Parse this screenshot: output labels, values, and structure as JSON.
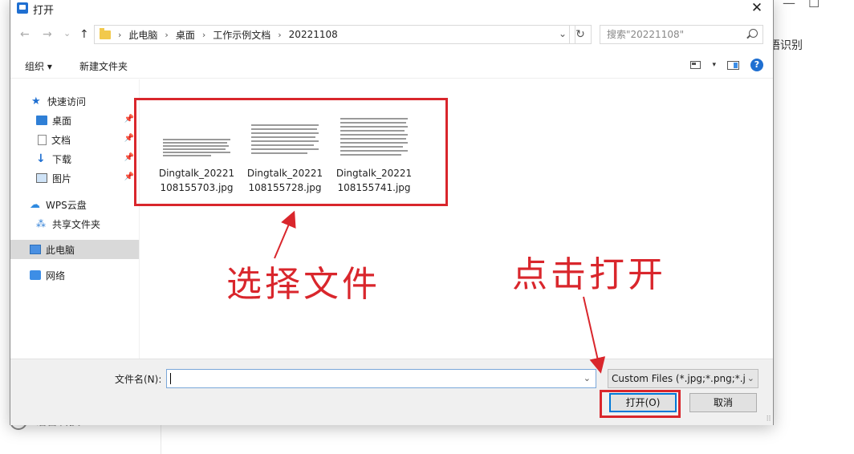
{
  "background_app": {
    "right_label": "语识别",
    "sidebar_item_label": "语音转换",
    "window_controls": [
      "—",
      "☐"
    ]
  },
  "dialog": {
    "title": "打开",
    "close_glyph": "✕",
    "nav": {
      "back_glyph": "←",
      "forward_glyph": "→",
      "recent_glyph": "⌄",
      "up_glyph": "↑",
      "breadcrumbs": [
        "此电脑",
        "桌面",
        "工作示例文档",
        "20221108"
      ],
      "crumb_separator": "›",
      "dropdown_glyph": "⌄",
      "refresh_glyph": "↻",
      "search_placeholder": "搜索\"20221108\""
    },
    "toolbar": {
      "organize_label": "组织 ▾",
      "new_folder_label": "新建文件夹",
      "view_dropdown_glyph": "▾",
      "help_glyph": "?"
    },
    "sidebar": {
      "items": [
        {
          "label": "快速访问",
          "icon": "star-icon",
          "glyph": "★",
          "pinned": false,
          "selected": false
        },
        {
          "label": "桌面",
          "icon": "desktop-icon",
          "pinned": true,
          "selected": false
        },
        {
          "label": "文档",
          "icon": "document-icon",
          "pinned": true,
          "selected": false
        },
        {
          "label": "下载",
          "icon": "download-icon",
          "glyph": "↓",
          "pinned": true,
          "selected": false
        },
        {
          "label": "图片",
          "icon": "pictures-icon",
          "pinned": true,
          "selected": false
        },
        {
          "label": "WPS云盘",
          "icon": "cloud-icon",
          "glyph": "☁",
          "pinned": false,
          "selected": false
        },
        {
          "label": "共享文件夹",
          "icon": "share-icon",
          "glyph": "⁂",
          "pinned": false,
          "selected": false
        },
        {
          "label": "此电脑",
          "icon": "computer-icon",
          "pinned": false,
          "selected": true
        },
        {
          "label": "网络",
          "icon": "network-icon",
          "pinned": false,
          "selected": false
        }
      ],
      "pin_glyph": "📌"
    },
    "files": [
      {
        "name": "Dingtalk_20221108155703.jpg",
        "name_display": "Dingtalk_20221\n108155703.jpg"
      },
      {
        "name": "Dingtalk_20221108155728.jpg",
        "name_display": "Dingtalk_20221\n108155728.jpg"
      },
      {
        "name": "Dingtalk_20221108155741.jpg",
        "name_display": "Dingtalk_20221\n108155741.jpg"
      }
    ],
    "bottom": {
      "filename_label": "文件名(N):",
      "filename_value": "",
      "filename_dropdown_glyph": "⌄",
      "filetype_value": "Custom Files (*.jpg;*.png;*.jp",
      "filetype_dropdown_glyph": "⌄",
      "open_label": "打开(O)",
      "cancel_label": "取消",
      "grip_glyph": "⠿"
    }
  },
  "annotations": {
    "select_file_text": "选择文件",
    "click_open_text": "点击打开",
    "color": "#d9262c"
  }
}
